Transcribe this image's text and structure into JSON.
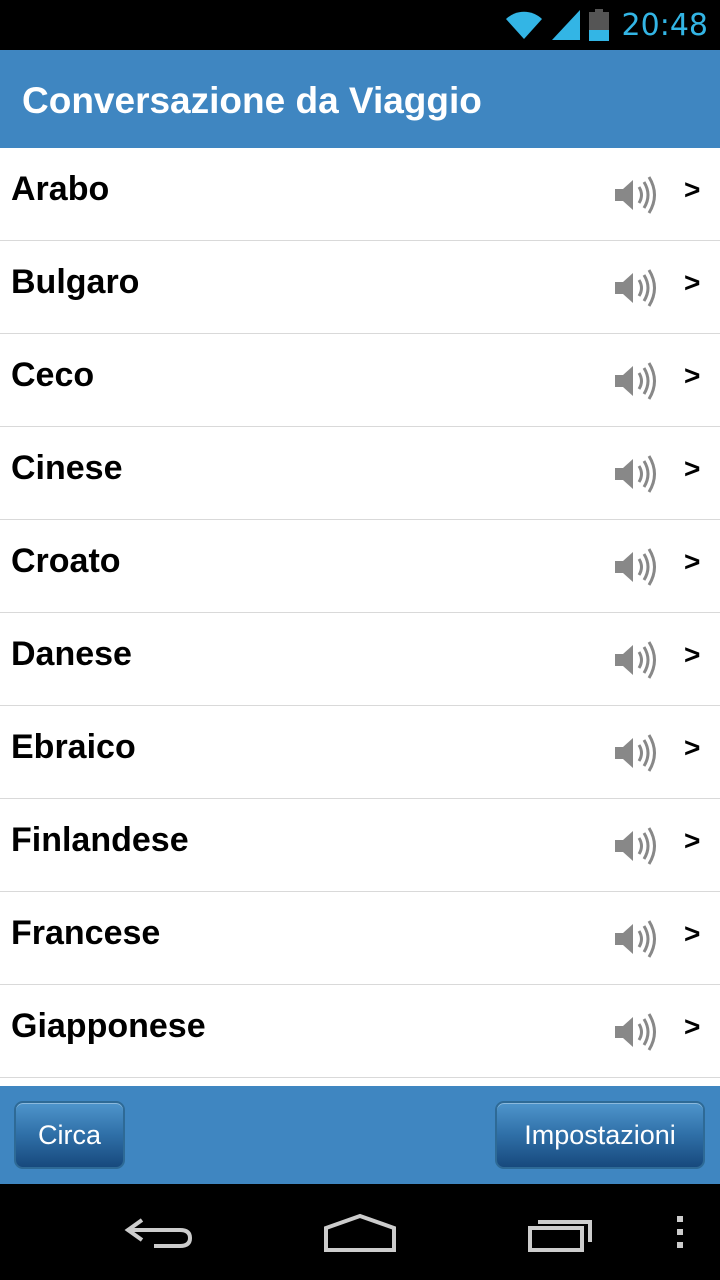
{
  "status_bar": {
    "time": "20:48",
    "icons": [
      "wifi-icon",
      "signal-icon",
      "battery-icon"
    ],
    "accent_color": "#33b5e5"
  },
  "action_bar": {
    "title": "Conversazione da Viaggio",
    "background": "#3f86c1"
  },
  "languages": [
    {
      "label": "Arabo",
      "icon": "speaker-icon",
      "chevron": ">"
    },
    {
      "label": "Bulgaro",
      "icon": "speaker-icon",
      "chevron": ">"
    },
    {
      "label": "Ceco",
      "icon": "speaker-icon",
      "chevron": ">"
    },
    {
      "label": "Cinese",
      "icon": "speaker-icon",
      "chevron": ">"
    },
    {
      "label": "Croato",
      "icon": "speaker-icon",
      "chevron": ">"
    },
    {
      "label": "Danese",
      "icon": "speaker-icon",
      "chevron": ">"
    },
    {
      "label": "Ebraico",
      "icon": "speaker-icon",
      "chevron": ">"
    },
    {
      "label": "Finlandese",
      "icon": "speaker-icon",
      "chevron": ">"
    },
    {
      "label": "Francese",
      "icon": "speaker-icon",
      "chevron": ">"
    },
    {
      "label": "Giapponese",
      "icon": "speaker-icon",
      "chevron": ">"
    }
  ],
  "bottom_bar": {
    "left_button": "Circa",
    "right_button": "Impostazioni"
  },
  "nav_bar": {
    "icons": [
      "back-icon",
      "home-icon",
      "recents-icon",
      "menu-icon"
    ]
  }
}
